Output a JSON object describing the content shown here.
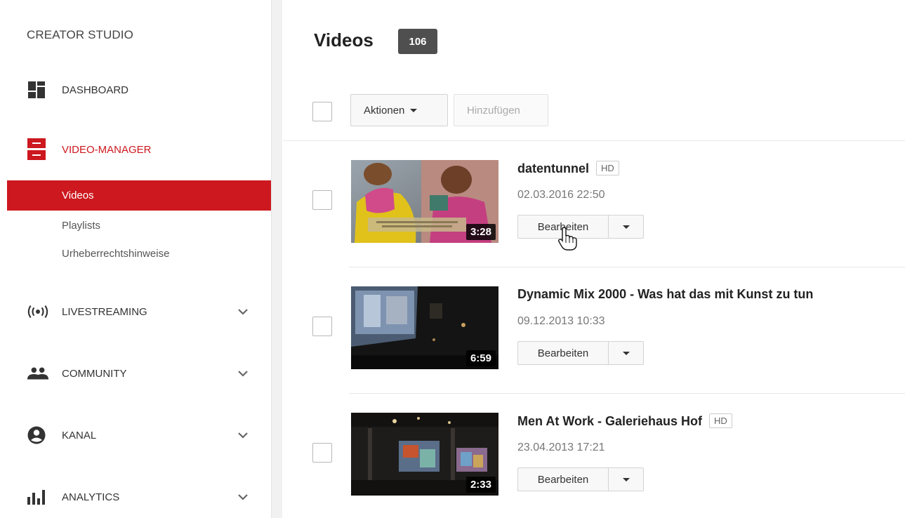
{
  "sidebar": {
    "title": "CREATOR STUDIO",
    "dashboard": {
      "label": "DASHBOARD",
      "icon": "dashboard-icon"
    },
    "video_manager": {
      "label": "VIDEO-MANAGER",
      "icon": "video-manager-icon",
      "accent": "#cc181e",
      "subitems": [
        {
          "label": "Videos",
          "active": true
        },
        {
          "label": "Playlists",
          "active": false
        },
        {
          "label": "Urheberrechtshinweise",
          "active": false
        }
      ]
    },
    "livestreaming": {
      "label": "LIVESTREAMING",
      "icon": "livestream-icon"
    },
    "community": {
      "label": "COMMUNITY",
      "icon": "community-icon"
    },
    "kanal": {
      "label": "KANAL",
      "icon": "account-circle-icon"
    },
    "analytics": {
      "label": "ANALYTICS",
      "icon": "analytics-icon"
    }
  },
  "main": {
    "title": "Videos",
    "count": "106",
    "toolbar": {
      "actions_label": "Aktionen",
      "add_label": "Hinzufügen"
    },
    "videos": [
      {
        "title": "datentunnel",
        "hd": "HD",
        "date": "02.03.2016 22:50",
        "duration": "3:28",
        "edit_label": "Bearbeiten"
      },
      {
        "title": "Dynamic Mix 2000 - Was hat das mit Kunst zu tun",
        "hd": "",
        "date": "09.12.2013 10:33",
        "duration": "6:59",
        "edit_label": "Bearbeiten"
      },
      {
        "title": "Men At Work - Galeriehaus Hof",
        "hd": "HD",
        "date": "23.04.2013 17:21",
        "duration": "2:33",
        "edit_label": "Bearbeiten"
      }
    ]
  },
  "colors": {
    "accent": "#cc181e",
    "badge_bg": "#4f4f4f"
  }
}
